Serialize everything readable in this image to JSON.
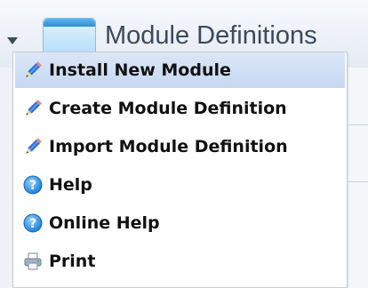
{
  "page": {
    "title": "Module Definitions"
  },
  "icons": {
    "toggle": "chevron-down-icon",
    "module": "module-window-icon",
    "pencil": "pencil-icon",
    "help": "help-icon",
    "print": "printer-icon"
  },
  "colors": {
    "highlight": "#c6d8f1",
    "help_blue": "#2b8be0",
    "pencil_body": "#2f6fd0"
  },
  "menu": {
    "items": [
      {
        "label": "Install New Module",
        "icon": "pencil-icon",
        "highlighted": true
      },
      {
        "label": "Create Module Definition",
        "icon": "pencil-icon",
        "highlighted": false
      },
      {
        "label": "Import Module Definition",
        "icon": "pencil-icon",
        "highlighted": false
      },
      {
        "label": "Help",
        "icon": "help-icon",
        "highlighted": false
      },
      {
        "label": "Online Help",
        "icon": "help-icon",
        "highlighted": false
      },
      {
        "label": "Print",
        "icon": "printer-icon",
        "highlighted": false
      }
    ]
  }
}
